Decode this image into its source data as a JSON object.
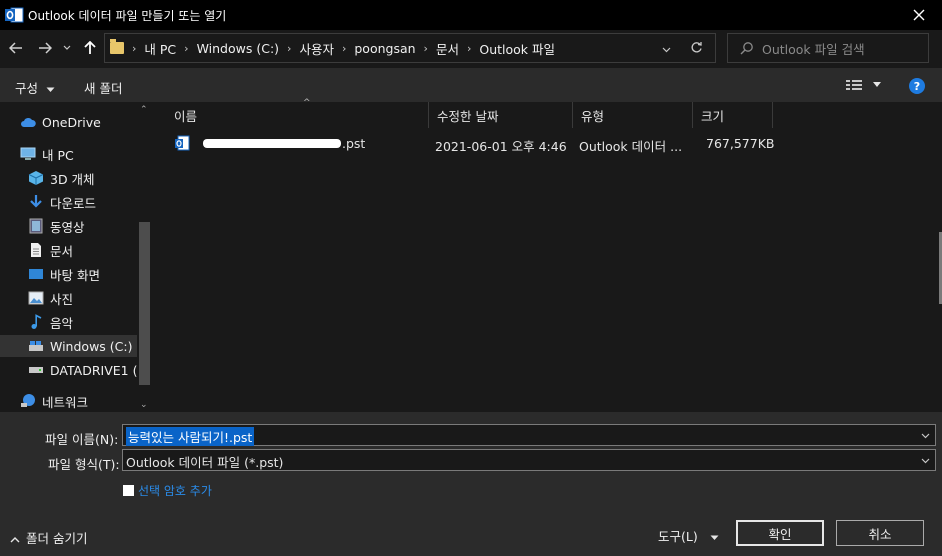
{
  "window": {
    "title": "Outlook 데이터 파일 만들기 또는 열기"
  },
  "nav": {
    "breadcrumbs": [
      "내 PC",
      "Windows  (C:)",
      "사용자",
      "poongsan",
      "문서",
      "Outlook 파일"
    ],
    "search_placeholder": "Outlook 파일 검색"
  },
  "toolbar": {
    "organize_label": "구성",
    "new_folder_label": "새 폴더"
  },
  "sidebar": {
    "items": [
      {
        "label": "OneDrive",
        "icon": "cloud-icon"
      },
      {
        "label": "내 PC",
        "icon": "pc-icon"
      },
      {
        "label": "3D 개체",
        "icon": "cube-icon"
      },
      {
        "label": "다운로드",
        "icon": "download-icon"
      },
      {
        "label": "동영상",
        "icon": "video-icon"
      },
      {
        "label": "문서",
        "icon": "document-icon"
      },
      {
        "label": "바탕 화면",
        "icon": "desktop-icon"
      },
      {
        "label": "사진",
        "icon": "picture-icon"
      },
      {
        "label": "음악",
        "icon": "music-icon"
      },
      {
        "label": "Windows  (C:)",
        "icon": "drive-icon"
      },
      {
        "label": "DATADRIVE1 (D",
        "icon": "drive-icon"
      },
      {
        "label": "네트워크",
        "icon": "network-icon"
      }
    ]
  },
  "filelist": {
    "columns": [
      "이름",
      "수정한 날짜",
      "유형",
      "크기"
    ],
    "rows": [
      {
        "name": ".pst",
        "modified": "2021-06-01 오후 4:46",
        "type": "Outlook 데이터 ...",
        "size": "767,577KB"
      }
    ]
  },
  "bottom": {
    "filename_label": "파일 이름(N):",
    "filename_value": "능력있는 사람되기!.pst",
    "filetype_label": "파일 형식(T):",
    "filetype_value": "Outlook 데이터 파일 (*.pst)",
    "password_label": "선택 암호 추가",
    "hide_folders_label": "폴더 숨기기",
    "tools_label": "도구(L)",
    "ok_label": "확인",
    "cancel_label": "취소"
  },
  "colors": {
    "accent": "#0a64c8",
    "link": "#2b8be8",
    "folder": "#e8c66a"
  }
}
